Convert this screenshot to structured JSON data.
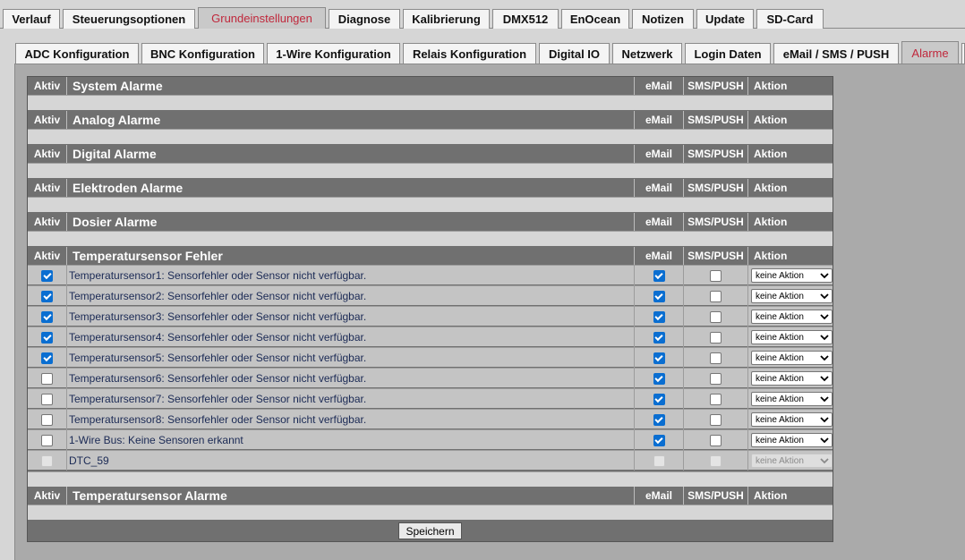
{
  "top_tabs": [
    {
      "label": "Verlauf"
    },
    {
      "label": "Steuerungsoptionen"
    },
    {
      "label": "Grundeinstellungen",
      "active": true
    },
    {
      "label": "Diagnose"
    },
    {
      "label": "Kalibrierung"
    },
    {
      "label": "DMX512"
    },
    {
      "label": "EnOcean"
    },
    {
      "label": "Notizen"
    },
    {
      "label": "Update"
    },
    {
      "label": "SD-Card"
    }
  ],
  "sub_tabs": [
    {
      "label": "ADC Konfiguration"
    },
    {
      "label": "BNC Konfiguration"
    },
    {
      "label": "1-Wire Konfiguration"
    },
    {
      "label": "Relais Konfiguration"
    },
    {
      "label": "Digital IO"
    },
    {
      "label": "Netzwerk"
    },
    {
      "label": "Login Daten"
    },
    {
      "label": "eMail / SMS / PUSH"
    },
    {
      "label": "Alarme",
      "active": true
    }
  ],
  "columns": {
    "aktiv": "Aktiv",
    "email": "eMail",
    "sms": "SMS/PUSH",
    "aktion": "Aktion"
  },
  "sections": [
    {
      "title": "System Alarme"
    },
    {
      "title": "Analog Alarme"
    },
    {
      "title": "Digital Alarme"
    },
    {
      "title": "Elektroden Alarme"
    },
    {
      "title": "Dosier Alarme"
    },
    {
      "title": "Temperatursensor Fehler"
    },
    {
      "title": "Temperatursensor Alarme"
    }
  ],
  "temp_rows": [
    {
      "label": "Temperatursensor1: Sensorfehler oder Sensor nicht verfügbar.",
      "active": true,
      "email": true,
      "sms": false,
      "action": "keine Aktion"
    },
    {
      "label": "Temperatursensor2: Sensorfehler oder Sensor nicht verfügbar.",
      "active": true,
      "email": true,
      "sms": false,
      "action": "keine Aktion"
    },
    {
      "label": "Temperatursensor3: Sensorfehler oder Sensor nicht verfügbar.",
      "active": true,
      "email": true,
      "sms": false,
      "action": "keine Aktion"
    },
    {
      "label": "Temperatursensor4: Sensorfehler oder Sensor nicht verfügbar.",
      "active": true,
      "email": true,
      "sms": false,
      "action": "keine Aktion"
    },
    {
      "label": "Temperatursensor5: Sensorfehler oder Sensor nicht verfügbar.",
      "active": true,
      "email": true,
      "sms": false,
      "action": "keine Aktion"
    },
    {
      "label": "Temperatursensor6: Sensorfehler oder Sensor nicht verfügbar.",
      "active": false,
      "email": true,
      "sms": false,
      "action": "keine Aktion"
    },
    {
      "label": "Temperatursensor7: Sensorfehler oder Sensor nicht verfügbar.",
      "active": false,
      "email": true,
      "sms": false,
      "action": "keine Aktion"
    },
    {
      "label": "Temperatursensor8: Sensorfehler oder Sensor nicht verfügbar.",
      "active": false,
      "email": true,
      "sms": false,
      "action": "keine Aktion"
    },
    {
      "label": "1-Wire Bus: Keine Sensoren erkannt",
      "active": false,
      "email": true,
      "sms": false,
      "action": "keine Aktion"
    },
    {
      "label": "DTC_59",
      "active": false,
      "email": false,
      "sms": false,
      "action": "keine Aktion",
      "disabled": true
    }
  ],
  "save_label": "Speichern",
  "colors": {
    "active_tab_text": "#c0283c",
    "checkbox_on": "#0a6ed1",
    "header_bg": "#707070"
  }
}
